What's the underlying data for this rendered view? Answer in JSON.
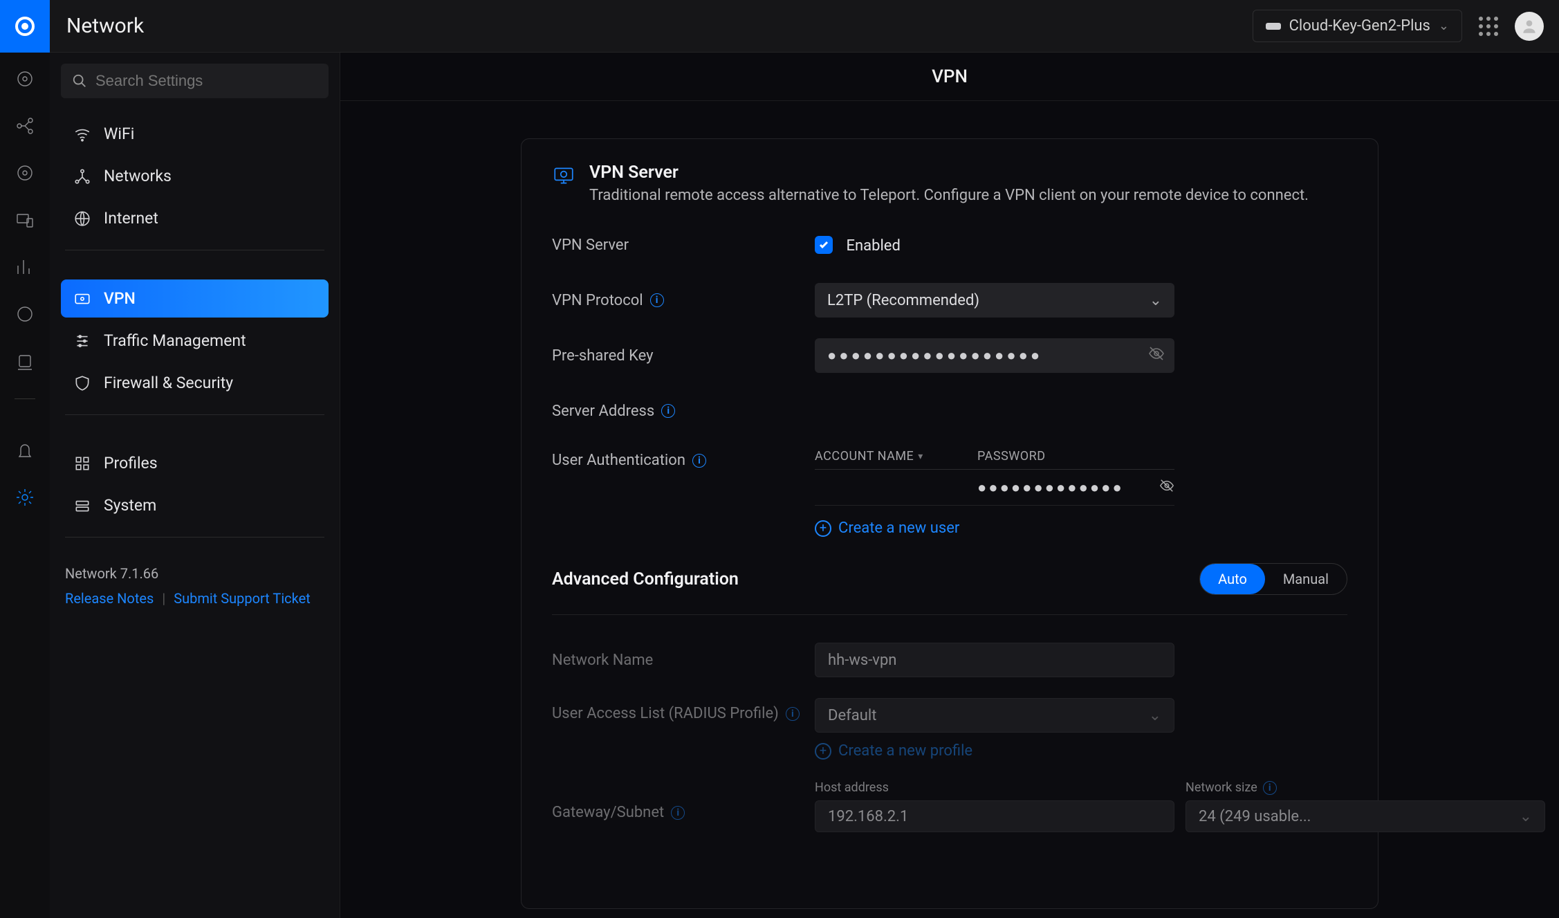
{
  "topbar": {
    "title": "Network",
    "device": "Cloud-Key-Gen2-Plus"
  },
  "sidebar": {
    "search_placeholder": "Search Settings",
    "group1": [
      {
        "id": "wifi",
        "label": "WiFi"
      },
      {
        "id": "networks",
        "label": "Networks"
      },
      {
        "id": "internet",
        "label": "Internet"
      }
    ],
    "group2": [
      {
        "id": "vpn",
        "label": "VPN"
      },
      {
        "id": "traffic",
        "label": "Traffic Management"
      },
      {
        "id": "firewall",
        "label": "Firewall & Security"
      }
    ],
    "group3": [
      {
        "id": "profiles",
        "label": "Profiles"
      },
      {
        "id": "system",
        "label": "System"
      }
    ],
    "version": "Network 7.1.66",
    "release_notes": "Release Notes",
    "support": "Submit Support Ticket"
  },
  "page": {
    "title": "VPN",
    "section_title": "VPN Server",
    "section_desc": "Traditional remote access alternative to Teleport. Configure a VPN client on your remote device to connect.",
    "labels": {
      "vpn_server": "VPN Server",
      "enabled": "Enabled",
      "vpn_protocol": "VPN Protocol",
      "preshared_key": "Pre-shared Key",
      "server_address": "Server Address",
      "user_auth": "User Authentication",
      "acc_col": "ACCOUNT NAME",
      "pw_col": "PASSWORD",
      "create_user": "Create a new user",
      "advanced": "Advanced Configuration",
      "auto": "Auto",
      "manual": "Manual",
      "net_name": "Network Name",
      "radius": "User Access List (RADIUS Profile)",
      "create_profile": "Create a new profile",
      "gateway": "Gateway/Subnet",
      "host_addr": "Host address",
      "net_size": "Network size"
    },
    "values": {
      "protocol": "L2TP (Recommended)",
      "psk_mask": "●●●●●●●●●●●●●●●●●●",
      "user_rows": [
        {
          "account": "",
          "password_mask": "●●●●●●●●●●●●●"
        }
      ],
      "net_name": "hh-ws-vpn",
      "radius_profile": "Default",
      "host_addr": "192.168.2.1",
      "net_size": "24 (249 usable..."
    }
  }
}
